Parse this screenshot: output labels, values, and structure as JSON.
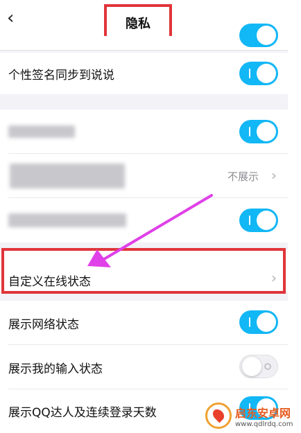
{
  "header": {
    "back_icon": "chevron-left-icon",
    "title": "隐私"
  },
  "rows": [
    {
      "label": "个性签名同步到说说",
      "toggle": "on"
    },
    {
      "label": "",
      "toggle": "on",
      "blurred": true
    },
    {
      "label": "",
      "value": "不展示",
      "blurred": true
    },
    {
      "label": "",
      "toggle": "on",
      "blurred": true
    },
    {
      "label": "自定义在线状态",
      "chevron": true
    },
    {
      "label": "展示网络状态",
      "toggle": "on"
    },
    {
      "label": "展示我的输入状态",
      "toggle": "off"
    },
    {
      "label": "展示QQ达人及连续登录天数",
      "toggle": "on"
    }
  ],
  "annotation": {
    "color": "#e0353a",
    "arrow_color": "#e040e8"
  },
  "colors": {
    "toggle_on": "#12b7f5",
    "background": "#f2f2f7"
  },
  "watermark": {
    "name": "启东安卓网",
    "url": "www.qdlrdq.com"
  }
}
